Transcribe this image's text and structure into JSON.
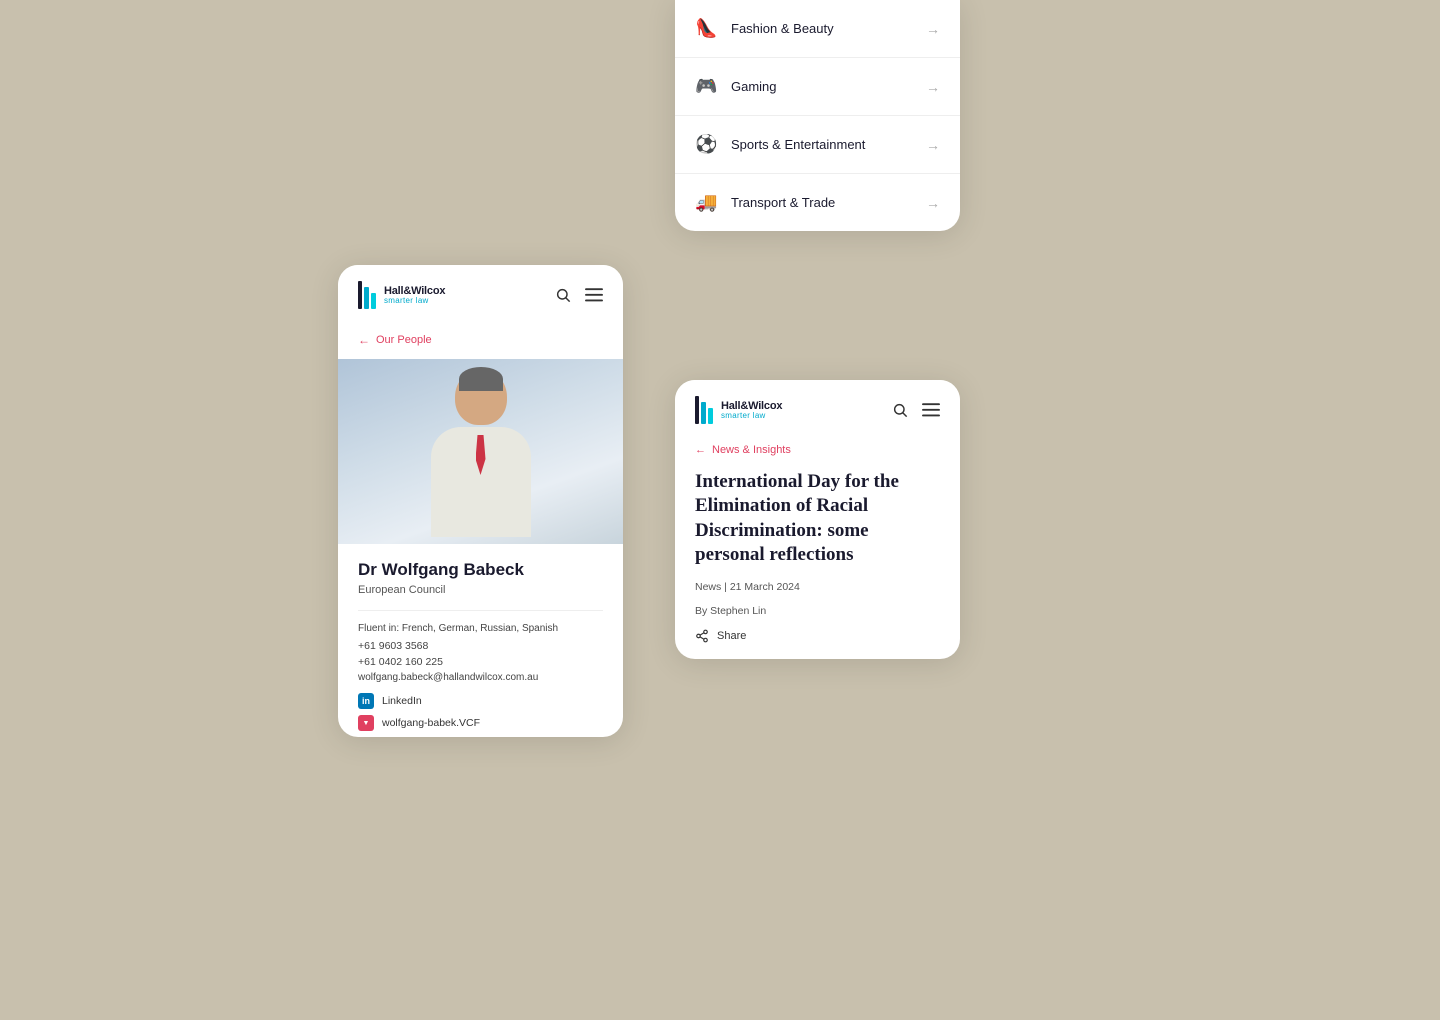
{
  "brand": {
    "name": "Hall&Wilcox",
    "tagline": "smarter law"
  },
  "left_card": {
    "breadcrumb": "Our People",
    "person": {
      "name": "Dr Wolfgang Babeck",
      "title": "European Council",
      "languages": "Fluent in: French, German, Russian, Spanish",
      "phone1": "+61 9603 3568",
      "phone2": "+61 0402 160 225",
      "email": "wolfgang.babeck@hallandwilcox.com.au",
      "linkedin_label": "LinkedIn",
      "vcf_label": "wolfgang-babek.VCF"
    }
  },
  "right_top_card": {
    "menu_items": [
      {
        "icon": "👠",
        "label": "Fashion & Beauty"
      },
      {
        "icon": "🎮",
        "label": "Gaming"
      },
      {
        "icon": "⚽",
        "label": "Sports & Entertainment"
      },
      {
        "icon": "🚚",
        "label": "Transport & Trade"
      }
    ]
  },
  "right_bottom_card": {
    "breadcrumb": "News & Insights",
    "article_title": "International Day for the Elimination of Racial Discrimination: some personal reflections",
    "meta": "News | 21 March 2024",
    "author": "By Stephen Lin",
    "share_label": "Share"
  }
}
